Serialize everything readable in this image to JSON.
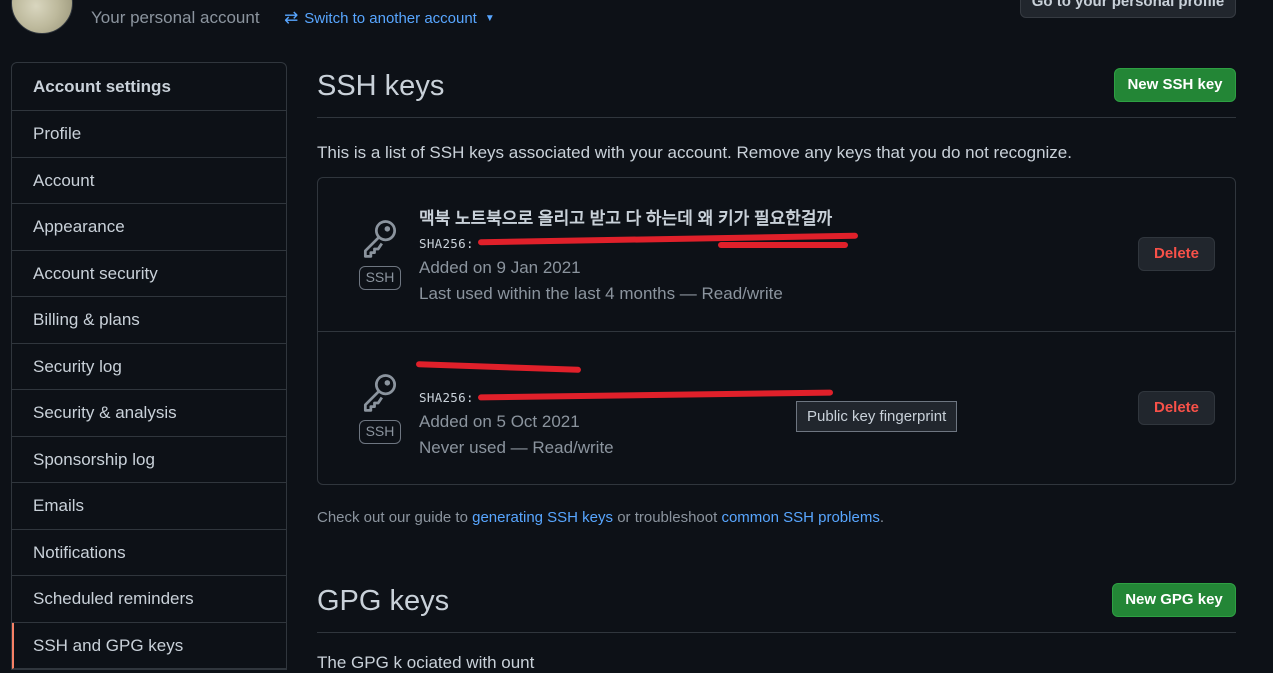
{
  "header": {
    "context_label": "Your personal account",
    "switch_label": "Switch to another account",
    "profile_button": "Go to your personal profile"
  },
  "sidebar": {
    "title": "Account settings",
    "items": [
      {
        "label": "Profile"
      },
      {
        "label": "Account"
      },
      {
        "label": "Appearance"
      },
      {
        "label": "Account security"
      },
      {
        "label": "Billing & plans"
      },
      {
        "label": "Security log"
      },
      {
        "label": "Security & analysis"
      },
      {
        "label": "Sponsorship log"
      },
      {
        "label": "Emails"
      },
      {
        "label": "Notifications"
      },
      {
        "label": "Scheduled reminders"
      },
      {
        "label": "SSH and GPG keys"
      }
    ],
    "selected": "SSH and GPG keys"
  },
  "ssh": {
    "title": "SSH keys",
    "new_button": "New SSH key",
    "intro": "This is a list of SSH keys associated with your account. Remove any keys that you do not recognize.",
    "keys": [
      {
        "title": "맥북 노트북으로 올리고 받고 다 하는데 왜 키가 필요한걸까",
        "fingerprint": "SHA256:",
        "added": "Added on 9 Jan 2021",
        "usage": "Last used within the last 4 months — Read/write",
        "badge": "SSH",
        "delete_label": "Delete"
      },
      {
        "title": "",
        "fingerprint": "SHA256:",
        "added": "Added on 5 Oct 2021",
        "usage": "Never used — Read/write",
        "badge": "SSH",
        "delete_label": "Delete"
      }
    ],
    "tooltip": "Public key fingerprint",
    "guide": {
      "prefix": "Check out our guide to ",
      "link1": "generating SSH keys",
      "middle": " or troubleshoot ",
      "link2": "common SSH problems",
      "suffix": "."
    }
  },
  "gpg": {
    "title": "GPG keys",
    "new_button": "New GPG key",
    "intro": "The  GPG k   ociated with   ount"
  },
  "colors": {
    "background": "#0d1117",
    "border": "#30363d",
    "link": "#58a6ff",
    "primary_button": "#238636",
    "danger_text": "#f85149",
    "selected_indicator": "#f78166"
  },
  "icons": [
    "arrow-switch-icon",
    "triangle-down-icon",
    "key-icon"
  ]
}
